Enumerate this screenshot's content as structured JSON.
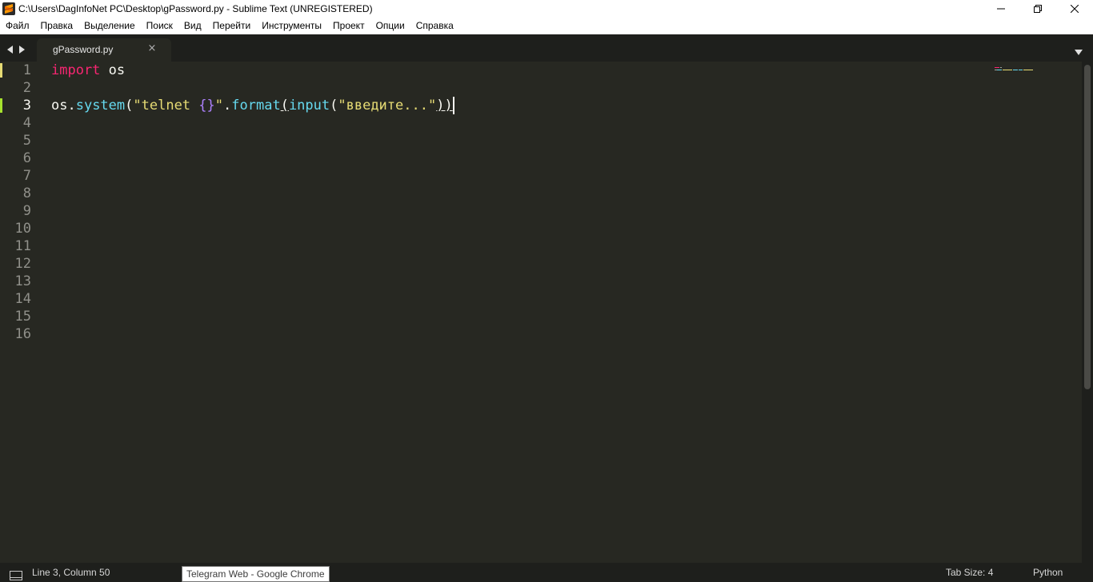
{
  "window": {
    "title": "C:\\Users\\DagInfoNet PC\\Desktop\\gPassword.py - Sublime Text (UNREGISTERED)"
  },
  "menu": [
    "Файл",
    "Правка",
    "Выделение",
    "Поиск",
    "Вид",
    "Перейти",
    "Инструменты",
    "Проект",
    "Опции",
    "Справка"
  ],
  "tabs": [
    {
      "label": "gPassword.py",
      "close": "×"
    }
  ],
  "editor": {
    "line_numbers": [
      "1",
      "2",
      "3",
      "4",
      "5",
      "6",
      "7",
      "8",
      "9",
      "10",
      "11",
      "12",
      "13",
      "14",
      "15",
      "16"
    ],
    "line1": {
      "keyword": "import",
      "module": " os"
    },
    "line3": {
      "obj": "os.",
      "fn1": "system",
      "p1": "(",
      "str1a": "\"telnet ",
      "placeholder": "{}",
      "str1b": "\"",
      "dot": ".",
      "fn2": "format",
      "p2": "(",
      "fn3": "input",
      "p3": "(",
      "str2": "\"введите...\"",
      "p4": "))"
    }
  },
  "colors": {
    "background": "#272822",
    "keyword": "#f92672",
    "function": "#66d9ef",
    "string": "#e6db74",
    "placeholder": "#ae81ff",
    "modified_marker": "#e6db74",
    "added_marker": "#a6e22e"
  },
  "status": {
    "position": "Line 3, Column 50",
    "tab_size": "Tab Size: 4",
    "syntax": "Python"
  },
  "tooltip": {
    "text": "Telegram Web - Google Chrome"
  },
  "icons": {
    "app": "sublime-text-icon",
    "minimize": "minimize-icon",
    "maximize": "restore-icon",
    "close": "close-icon",
    "nav_back": "arrow-left-icon",
    "nav_forward": "arrow-right-icon",
    "tab_dropdown": "chevron-down-icon",
    "status_panel": "panel-toggle-icon"
  }
}
